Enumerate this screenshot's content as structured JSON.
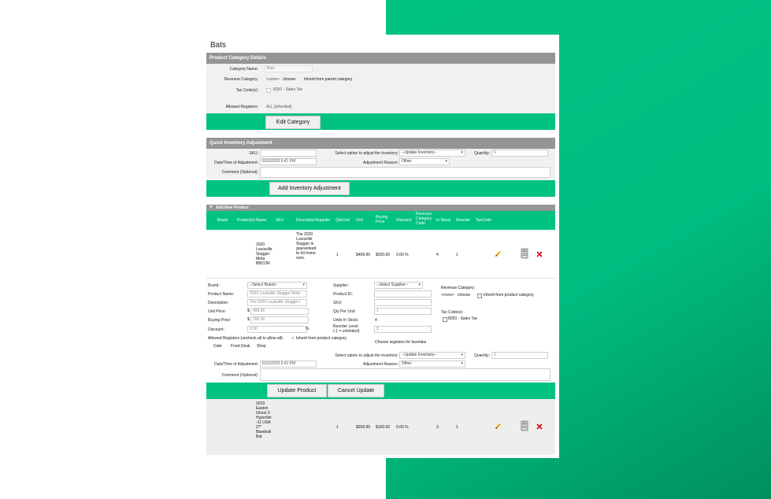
{
  "page_title": "Bats",
  "category_section": {
    "header": "Product Category Details",
    "name_label": "Category Name:",
    "name_value": "Bats",
    "revenue_label": "Revenue Category:",
    "revenue_value": "<none>",
    "revenue_link": "choose",
    "revenue_inherit": "Inherit from parent category",
    "tax_label": "Tax Code(s):",
    "tax_value": "8250 - Sales Tax",
    "registers_label": "Allowed Registers:",
    "registers_value": "ALL [inherited]",
    "edit_button": "Edit Category"
  },
  "quick_inventory": {
    "header": "Quick Inventory Adjustment",
    "sku_label": "SKU:",
    "option_label": "Select option to adjust the inventory:",
    "option_value": "--Update Inventory--",
    "quantity_label": "Quantity:",
    "quantity_value": "0",
    "datetime_label": "Date/Time of Adjustment:",
    "datetime_value": "6/10/2020 6:41 PM",
    "reason_label": "Adjustment Reason:",
    "reason_value": "Other",
    "comment_label": "Comment (Optional):",
    "add_button": "Add Inventory Adjustment"
  },
  "products": {
    "add_new": "Add New Product",
    "columns": [
      "Brand",
      "Product(s)",
      "Name",
      "SKU",
      "Description",
      "Supplier",
      "Qty/Unit",
      "Unit",
      "Buying Price",
      "Discount",
      "Revenue Category Code",
      "In Stock",
      "Reorder",
      "TaxCode"
    ],
    "rows": [
      {
        "name": "2020 Louisville Slugger Meta BBCOR",
        "description": "The 2020 Louisville Slugger is guaranteed to hit home runs.",
        "qty": "1",
        "unit": "$499.95",
        "buying": "$200.00",
        "discount": "0.00 %",
        "in_stock": "4",
        "reorder": "1"
      },
      {
        "name": "2019 Easton Ghost X Hyperlite -11 USA 27\" Baseball Bat",
        "description": "",
        "qty": "1",
        "unit": "$209.95",
        "buying": "$100.00",
        "discount": "0.00 %",
        "in_stock": "3",
        "reorder": "1"
      }
    ]
  },
  "edit_form": {
    "brand_label": "Brand:",
    "brand_value": "--Select Brand--",
    "product_name_label": "Product Name:",
    "product_name_value": "2020 Louisville Slugger Meta",
    "description_label": "Description:",
    "description_value": "The 2020 Louisville Slugger i",
    "unit_price_label": "Unit Price:",
    "unit_price_value": "499.95",
    "buying_price_label": "Buying Price:",
    "buying_price_value": "200.00",
    "discount_label": "Discount:",
    "discount_value": "0.00",
    "currency": "$",
    "percent": "%",
    "supplier_label": "Supplier:",
    "supplier_value": "--Select Supplier--",
    "product_id_label": "Product ID:",
    "sku_label": "SKU:",
    "qty_per_unit_label": "Qty Per Unit:",
    "qty_per_unit_value": "1",
    "units_in_stock_label": "Units In Stock:",
    "units_in_stock_value": "4",
    "reorder_label": "Reorder Level:",
    "reorder_sub": "(-1 = unlimited)",
    "reorder_value": "1",
    "revenue_label": "Revenue Category:",
    "revenue_value": "<none>",
    "revenue_link": "choose",
    "revenue_inherit": "Inherit from product category",
    "tax_label": "Tax Code(s):",
    "tax_value": "8250 - Sales Tax",
    "registers_label": "Allowed Registers (uncheck all to allow all):",
    "registers_inherit": "Inherit from product category",
    "registers": [
      "Cafe",
      "Front Desk",
      "Shop"
    ],
    "choose_registers": "Choose registers for favorites",
    "option_label": "Select option to adjust the inventory:",
    "option_value": "--Update Inventory--",
    "quantity_label": "Quantity:",
    "quantity_value": "0",
    "datetime_label": "Date/Time of Adjustment:",
    "datetime_value": "6/10/2020 6:41 PM",
    "reason_label": "Adjustment Reason:",
    "reason_value": "Other",
    "comment_label": "Comment (Optional):",
    "update_button": "Update Product",
    "cancel_button": "Cancel Update"
  },
  "colors": {
    "brand_green": "#00c283",
    "header_gray": "#959595",
    "panel_gray": "#f1f1f1",
    "delete_red": "#d9141a",
    "link_blue": "#2233cc"
  }
}
